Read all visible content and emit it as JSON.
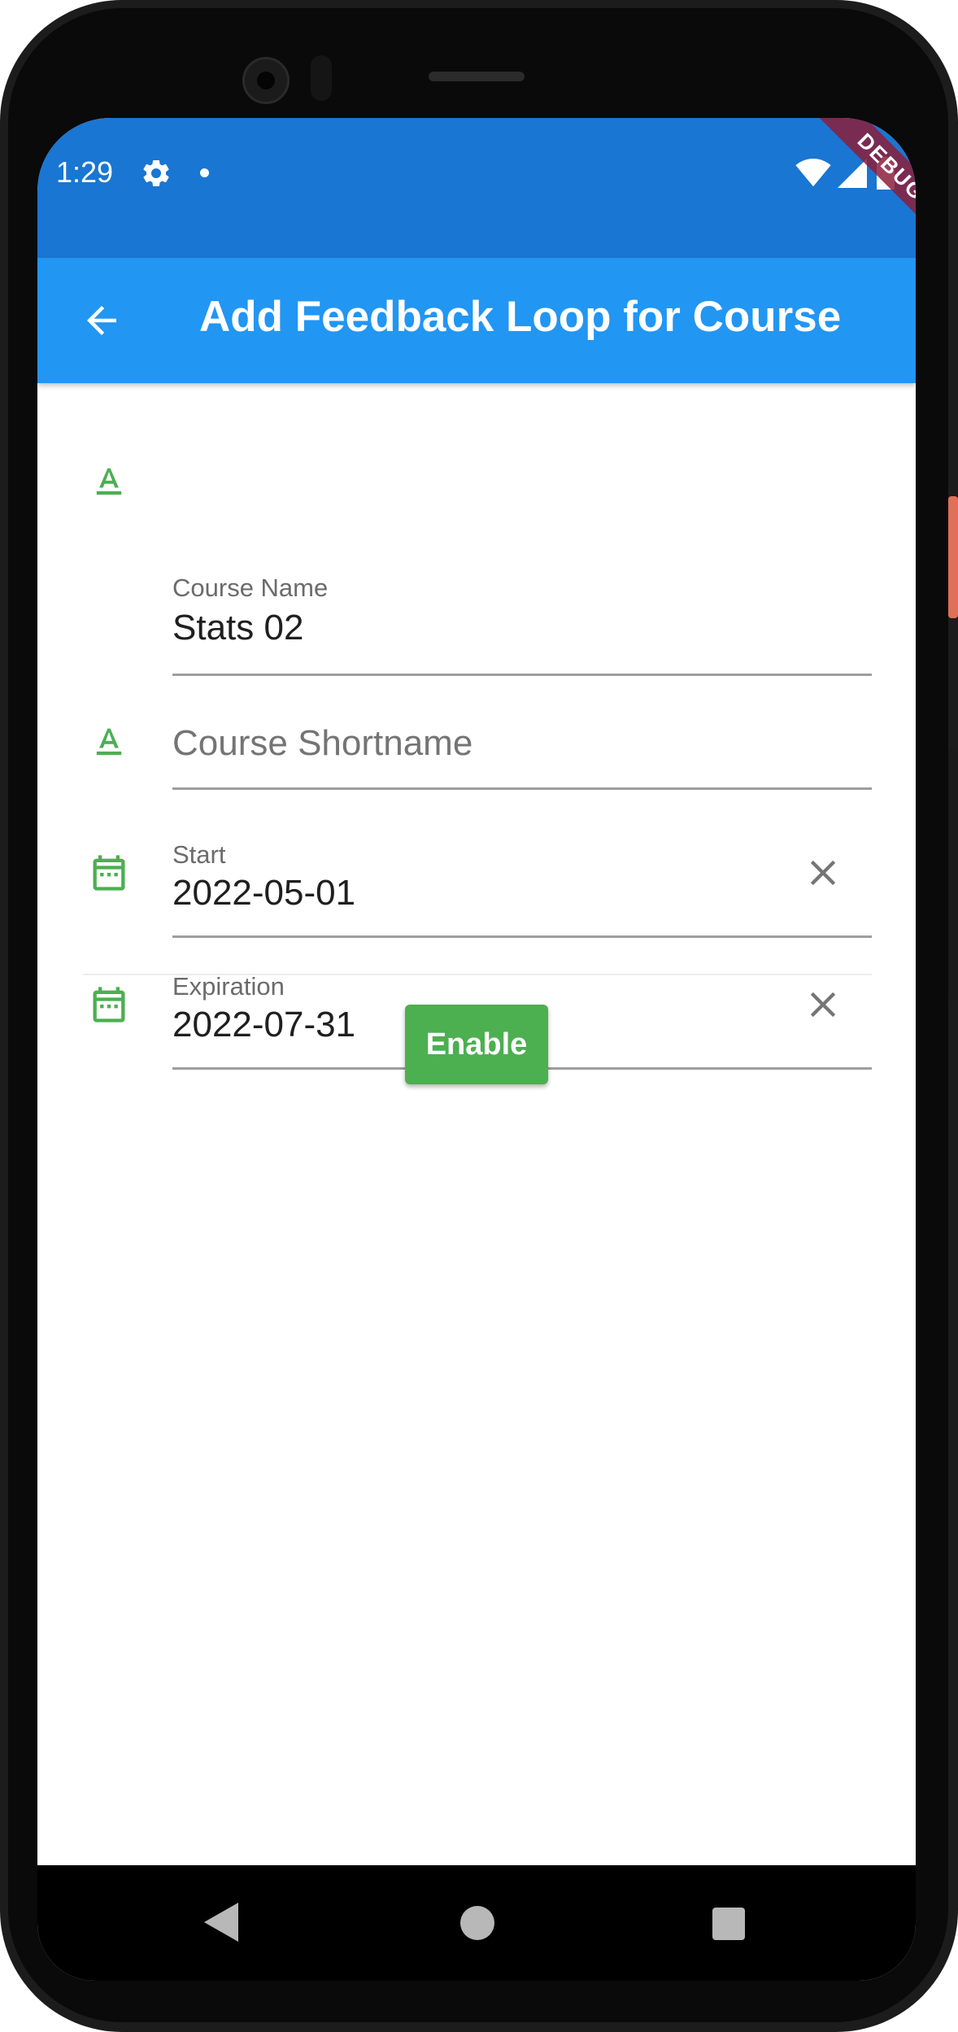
{
  "status_bar": {
    "time": "1:29",
    "debug_label": "DEBUG",
    "background_color": "#1976d2",
    "icons": [
      "gear-icon",
      "notification-dot-icon",
      "wifi-icon",
      "signal-icon",
      "battery-icon"
    ]
  },
  "app_bar": {
    "title": "Add Feedback Loop for Course",
    "back_icon": "arrow-back-icon",
    "background_color": "#2196f3"
  },
  "form": {
    "course_name": {
      "label": "Course Name",
      "value": "Stats 02",
      "icon": "text-format-icon"
    },
    "course_shortname": {
      "placeholder": "Course Shortname",
      "value": "",
      "icon": "text-format-icon"
    },
    "start": {
      "label": "Start",
      "value": "2022-05-01",
      "icon": "calendar-icon",
      "clear_icon": "close-icon"
    },
    "expiration": {
      "label": "Expiration",
      "value": "2022-07-31",
      "icon": "calendar-icon",
      "clear_icon": "close-icon"
    },
    "accent_color": "#4caf50"
  },
  "actions": {
    "enable_label": "Enable"
  },
  "nav_bar": {
    "icons": [
      "nav-back-icon",
      "nav-home-icon",
      "nav-recents-icon"
    ]
  }
}
